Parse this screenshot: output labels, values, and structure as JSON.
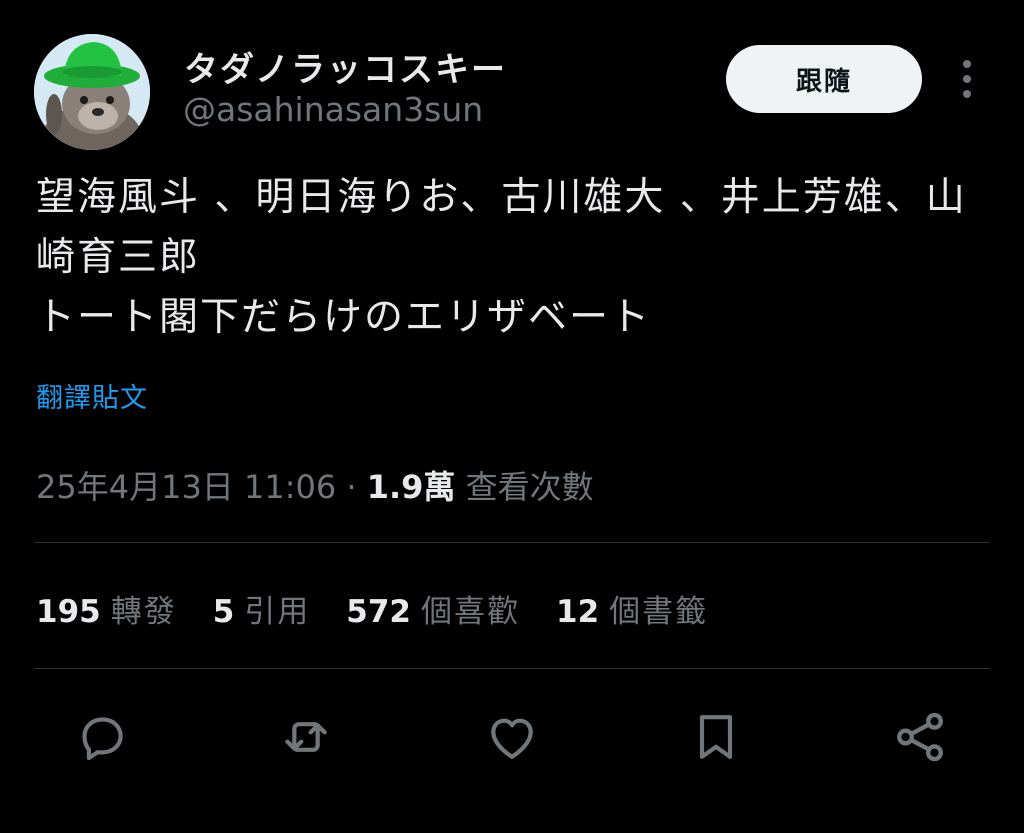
{
  "author": {
    "display_name": "タダノラッコスキー",
    "handle": "@asahinasan3sun",
    "avatar": "sea-otter-wearing-green-hat"
  },
  "follow_button": {
    "label": "跟隨"
  },
  "more_icon": "more-vertical-icon",
  "tweet": {
    "text": "望海風斗 、明日海りお、古川雄大 、井上芳雄、山崎育三郎\nトート閣下だらけのエリザベート",
    "translate_label": "翻譯貼文"
  },
  "meta": {
    "timestamp": "25年4月13日 11:06",
    "separator": " · ",
    "views_count": "1.9萬",
    "views_label": " 查看次數"
  },
  "stats": [
    {
      "num": "195",
      "label": "轉發"
    },
    {
      "num": "5",
      "label": "引用"
    },
    {
      "num": "572",
      "label": "個喜歡"
    },
    {
      "num": "12",
      "label": "個書籤"
    }
  ],
  "actions": [
    {
      "name": "reply",
      "icon": "reply-icon"
    },
    {
      "name": "retweet",
      "icon": "retweet-icon"
    },
    {
      "name": "like",
      "icon": "heart-icon"
    },
    {
      "name": "bookmark",
      "icon": "bookmark-icon"
    },
    {
      "name": "share",
      "icon": "share-icon"
    }
  ],
  "colors": {
    "background": "#000000",
    "text": "#e7e9ea",
    "secondary": "#71767b",
    "link": "#1d9bf0",
    "divider": "#2f3336",
    "button_bg": "#eff3f4"
  }
}
